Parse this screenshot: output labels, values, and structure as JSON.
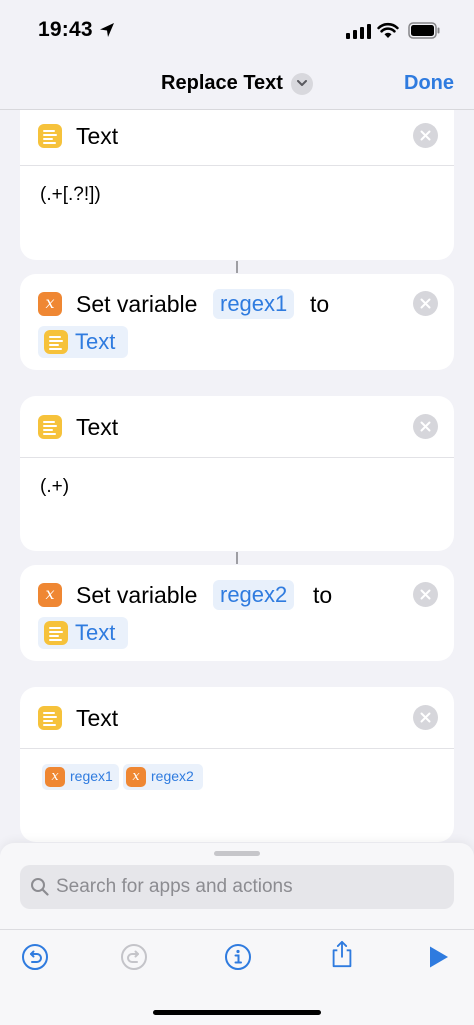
{
  "status_bar": {
    "time": "19:43"
  },
  "nav": {
    "title": "Replace Text",
    "done_label": "Done"
  },
  "actions": [
    {
      "type": "text",
      "label": "Text",
      "content": "(.+[.?!])"
    },
    {
      "type": "set_variable",
      "label_prefix": "Set variable",
      "variable": "regex1",
      "label_to": "to",
      "value": "Text"
    },
    {
      "type": "text",
      "label": "Text",
      "content": "(.+)"
    },
    {
      "type": "set_variable",
      "label_prefix": "Set variable",
      "variable": "regex2",
      "label_to": "to",
      "value": "Text"
    },
    {
      "type": "text",
      "label": "Text",
      "tokens": [
        "regex1",
        "regex2"
      ]
    }
  ],
  "sheet": {
    "search_placeholder": "Search for apps and actions"
  },
  "colors": {
    "accent": "#2f7bdf",
    "text_action_icon": "#f6c23b",
    "variable_icon": "#ef8733",
    "background": "#f2f2f7"
  }
}
